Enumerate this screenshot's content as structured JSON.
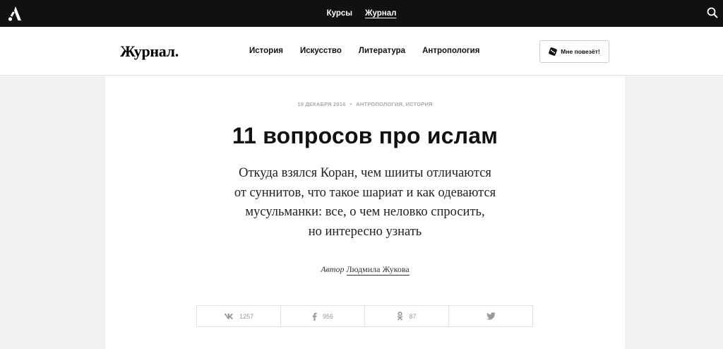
{
  "topbar": {
    "logo_icon": "arzamas-a-logo",
    "nav": [
      {
        "label": "Курсы",
        "active": false
      },
      {
        "label": "Журнал",
        "active": true
      }
    ],
    "search_icon": "search-icon"
  },
  "header": {
    "brand": "Журнал.",
    "nav": [
      "История",
      "Искусство",
      "Литература",
      "Антропология"
    ],
    "lucky_label": "Мне повезёт!",
    "lucky_icon": "dice-icon"
  },
  "article": {
    "date": "19 ДЕКАБРЯ 2016",
    "categories": "АНТРОПОЛОГИЯ, ИСТОРИЯ",
    "title": "11 вопросов про ислам",
    "lead_lines": [
      "Откуда взялся Коран, чем шииты отличаются",
      "от суннитов, что такое шариат и как одеваются",
      "мусульманки: все, о чем неловко спросить,",
      "но интересно узнать"
    ],
    "author_label": "Автор",
    "author_name": "Людмила Жукова"
  },
  "share": [
    {
      "network": "vk",
      "icon": "vk-icon",
      "count": "1257"
    },
    {
      "network": "facebook",
      "icon": "facebook-icon",
      "count": "956"
    },
    {
      "network": "odnoklassniki",
      "icon": "ok-icon",
      "count": "87"
    },
    {
      "network": "twitter",
      "icon": "twitter-icon",
      "count": ""
    }
  ]
}
